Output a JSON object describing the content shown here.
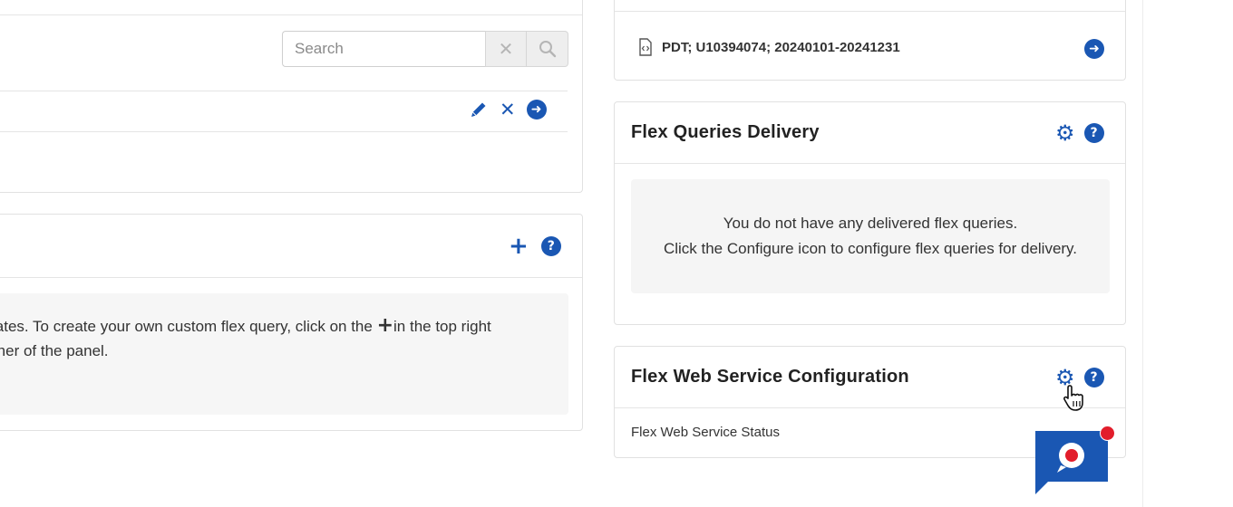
{
  "left_top_panel": {
    "search": {
      "placeholder": "Search"
    },
    "search_clear_icon": "close-icon",
    "search_submit_icon": "search-icon",
    "row_actions": [
      "edit-icon",
      "delete-icon",
      "open-arrow-icon"
    ]
  },
  "left_bottom_panel": {
    "header_actions": [
      "plus-icon",
      "help-icon"
    ],
    "message": {
      "line1_before": "lates. To create your own custom flex query, click on the ",
      "line1_after": "in the top right",
      "line2": "rner of the panel."
    }
  },
  "right_top_panel": {
    "report": {
      "label": "PDT; U10394074; 20240101-20241231",
      "icon": "code-file-icon"
    }
  },
  "flex_delivery": {
    "title": "Flex Queries Delivery",
    "message_line1": "You do not have any delivered flex queries.",
    "message_line2": "Click the Configure icon to configure flex queries for delivery."
  },
  "flex_web_service": {
    "title": "Flex Web Service Configuration",
    "status_label": "Flex Web Service Status"
  },
  "colors": {
    "accent": "#1a57b3",
    "notification": "#e21d2b"
  }
}
